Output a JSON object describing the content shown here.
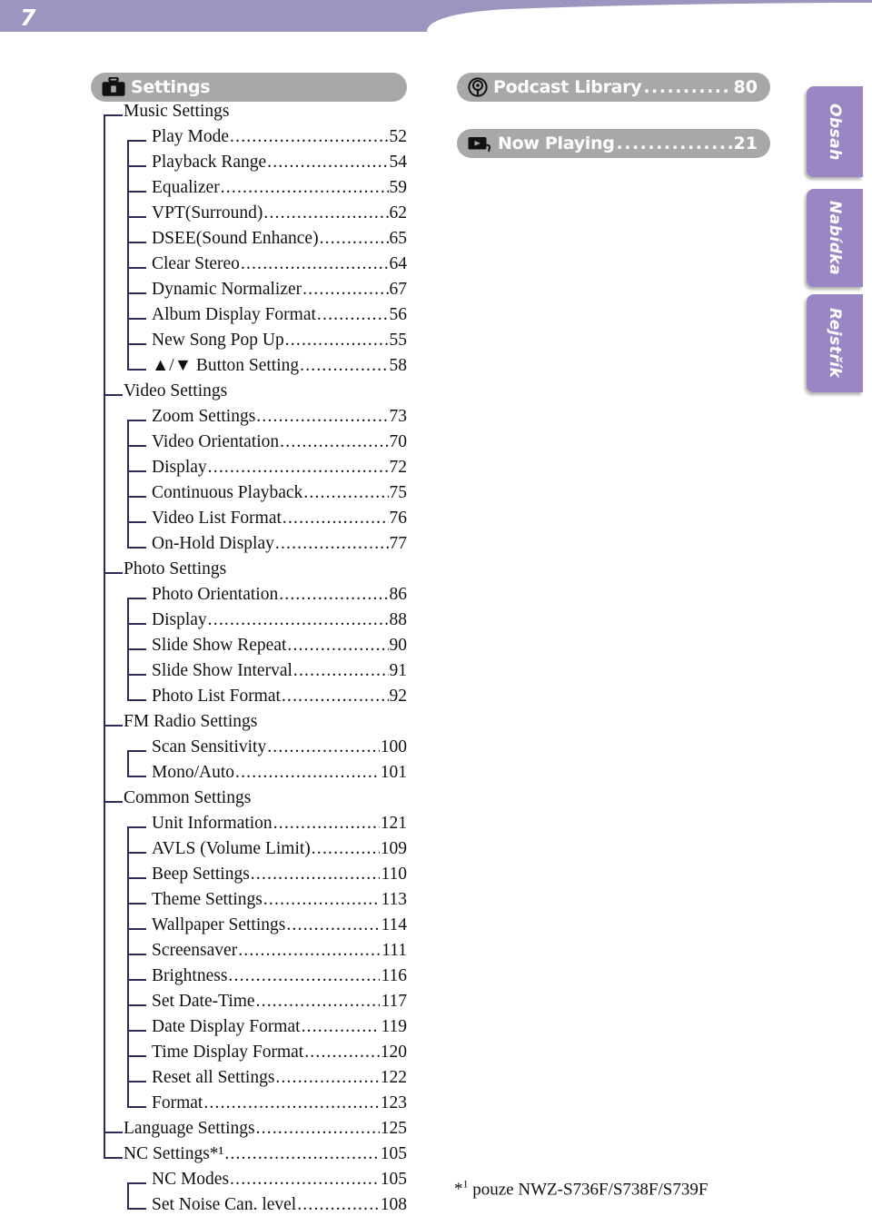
{
  "page": {
    "number": "7",
    "header_color": "#9b96bf",
    "pill_color": "#a8a8a8",
    "tab_color": "#9b86c4",
    "tree_line_color": "#2c2c59"
  },
  "settings_section": {
    "icon": "toolbox-icon",
    "title": "Settings"
  },
  "toc": [
    {
      "level": 1,
      "label": "Music Settings",
      "page": "",
      "icons": []
    },
    {
      "level": 2,
      "label": "Play Mode",
      "page": "52",
      "icons": []
    },
    {
      "level": 2,
      "label": "Playback Range",
      "page": "54",
      "icons": []
    },
    {
      "level": 2,
      "label": "Equalizer",
      "page": "59",
      "icons": []
    },
    {
      "level": 2,
      "label": "VPT(Surround)",
      "page": "62",
      "icons": []
    },
    {
      "level": 2,
      "label": "DSEE(Sound Enhance)",
      "page": "65",
      "icons": []
    },
    {
      "level": 2,
      "label": "Clear Stereo",
      "page": "64",
      "icons": []
    },
    {
      "level": 2,
      "label": "Dynamic Normalizer",
      "page": "67",
      "icons": []
    },
    {
      "level": 2,
      "label": "Album Display Format",
      "page": "56",
      "icons": []
    },
    {
      "level": 2,
      "label": "New Song Pop Up",
      "page": "55",
      "icons": []
    },
    {
      "level": 2,
      "label": "▲/▼ Button Setting",
      "page": "58",
      "icons": []
    },
    {
      "level": 1,
      "label": "Video Settings",
      "page": "",
      "icons": []
    },
    {
      "level": 2,
      "label": "Zoom Settings",
      "page": "73",
      "icons": []
    },
    {
      "level": 2,
      "label": "Video Orientation",
      "page": "70",
      "icons": []
    },
    {
      "level": 2,
      "label": "Display",
      "page": "72",
      "icons": []
    },
    {
      "level": 2,
      "label": "Continuous Playback",
      "page": "75",
      "icons": []
    },
    {
      "level": 2,
      "label": "Video List Format",
      "page": "76",
      "icons": []
    },
    {
      "level": 2,
      "label": "On-Hold Display",
      "page": "77",
      "icons": []
    },
    {
      "level": 1,
      "label": "Photo Settings",
      "page": "",
      "icons": []
    },
    {
      "level": 2,
      "label": "Photo Orientation",
      "page": "86",
      "icons": []
    },
    {
      "level": 2,
      "label": "Display",
      "page": "88",
      "icons": []
    },
    {
      "level": 2,
      "label": "Slide Show Repeat",
      "page": "90",
      "icons": []
    },
    {
      "level": 2,
      "label": "Slide Show Interval",
      "page": "91",
      "icons": []
    },
    {
      "level": 2,
      "label": "Photo List Format",
      "page": "92",
      "icons": []
    },
    {
      "level": 1,
      "label": "FM Radio Settings",
      "page": "",
      "icons": []
    },
    {
      "level": 2,
      "label": "Scan Sensitivity",
      "page": "100",
      "icons": []
    },
    {
      "level": 2,
      "label": "Mono/Auto",
      "page": "101",
      "icons": []
    },
    {
      "level": 1,
      "label": "Common Settings",
      "page": "",
      "icons": []
    },
    {
      "level": 2,
      "label": "Unit Information",
      "page": "121",
      "icons": []
    },
    {
      "level": 2,
      "label": "AVLS (Volume Limit)",
      "page": "109",
      "icons": []
    },
    {
      "level": 2,
      "label": "Beep Settings",
      "page": "110",
      "icons": []
    },
    {
      "level": 2,
      "label": "Theme Settings",
      "page": "113",
      "icons": []
    },
    {
      "level": 2,
      "label": "Wallpaper Settings",
      "page": "114",
      "icons": []
    },
    {
      "level": 2,
      "label": "Screensaver",
      "page": "111",
      "icons": []
    },
    {
      "level": 2,
      "label": "Brightness",
      "page": "116",
      "icons": []
    },
    {
      "level": 2,
      "label": "Set Date-Time",
      "page": "117",
      "icons": []
    },
    {
      "level": 2,
      "label": "Date Display Format",
      "page": "119",
      "icons": []
    },
    {
      "level": 2,
      "label": "Time Display Format",
      "page": "120",
      "icons": []
    },
    {
      "level": 2,
      "label": "Reset all Settings",
      "page": "122",
      "icons": []
    },
    {
      "level": 2,
      "label": "Format",
      "page": "123",
      "icons": []
    },
    {
      "level": 1,
      "label": "Language Settings",
      "page": "125",
      "icons": []
    },
    {
      "level": 1,
      "label": "NC Settings*¹",
      "page": "105",
      "icons": []
    },
    {
      "level": 2,
      "label": "NC Modes",
      "page": "105",
      "icons": []
    },
    {
      "level": 2,
      "label": "Set Noise Can. level",
      "page": "108",
      "icons": []
    }
  ],
  "right_column": {
    "entries": [
      {
        "icon": "podcast-icon",
        "label": "Podcast Library",
        "page": "80"
      },
      {
        "icon": "now-playing-icon",
        "label": "Now Playing",
        "page": "21"
      }
    ]
  },
  "footnote": {
    "marker": "*1",
    "text": "pouze NWZ-S736F/S738F/S739F"
  },
  "side_tabs": [
    {
      "label": "Obsah"
    },
    {
      "label": "Nabídka"
    },
    {
      "label": "Rejstřík"
    }
  ]
}
